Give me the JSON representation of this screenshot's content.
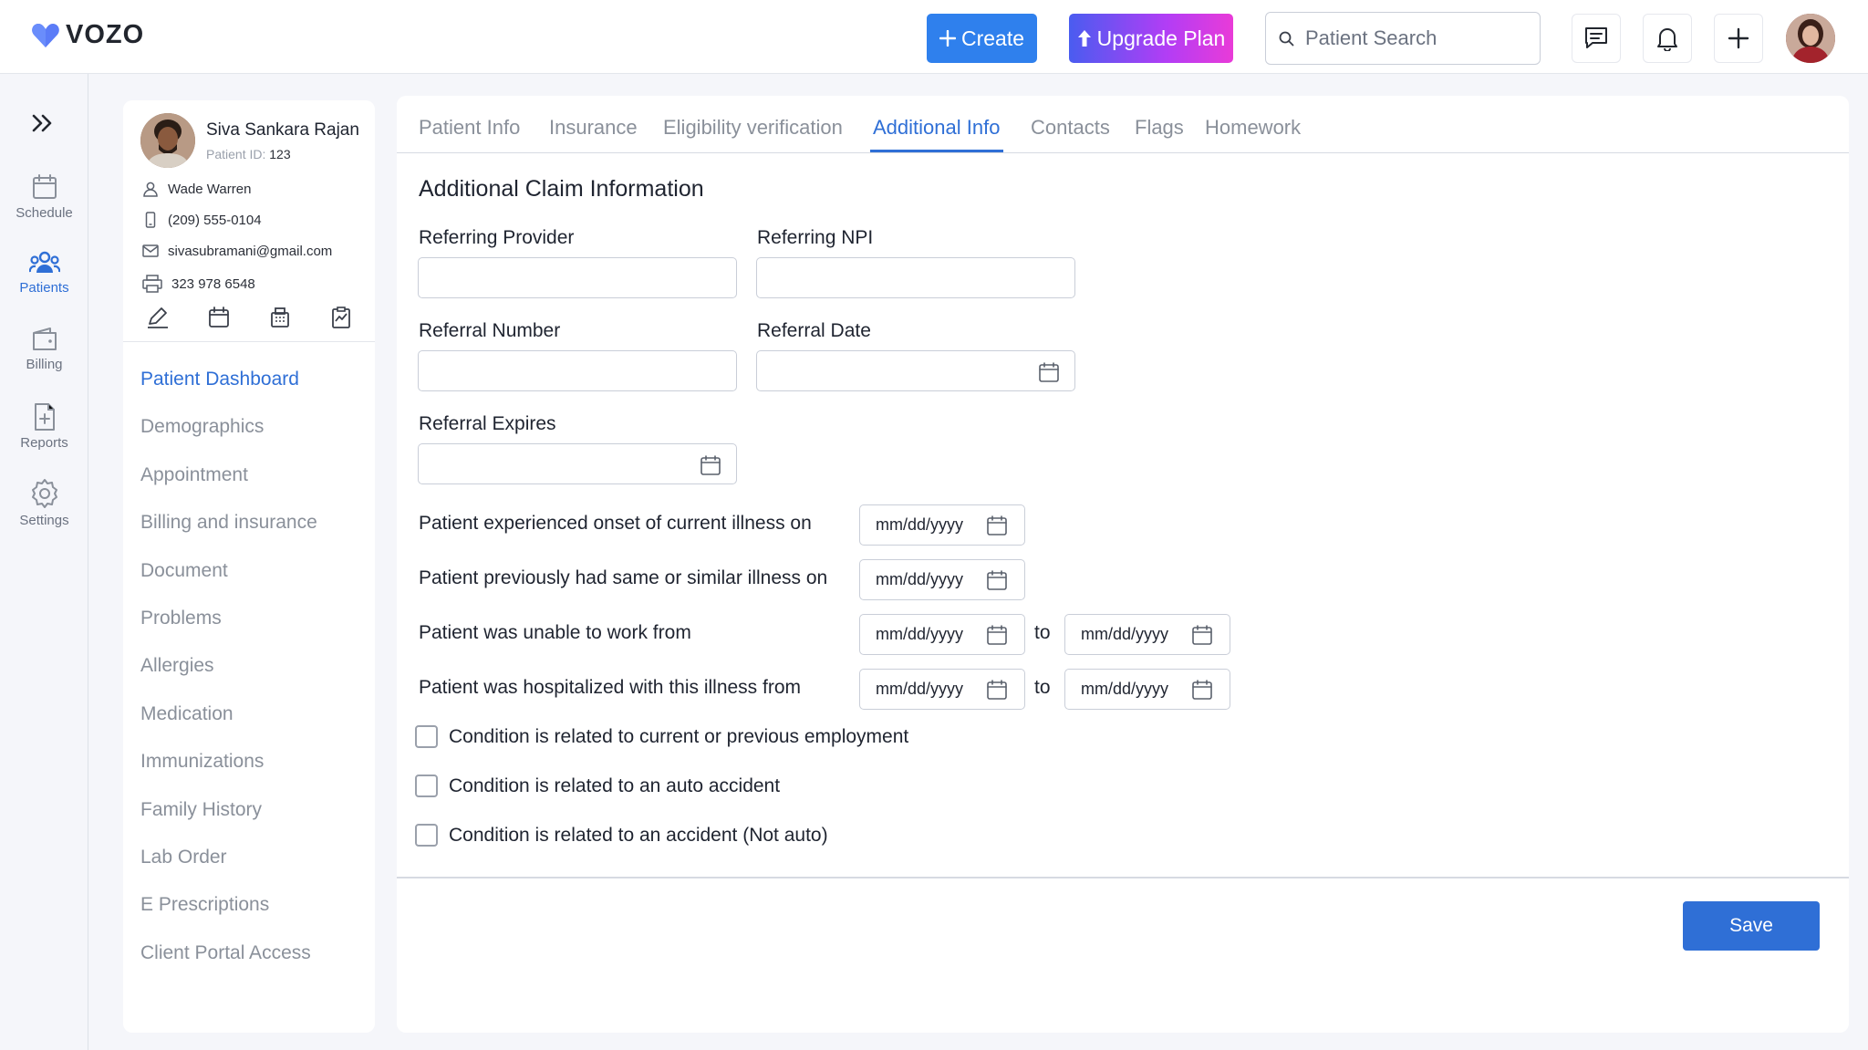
{
  "app": {
    "name": "VOZO"
  },
  "header": {
    "create_label": "Create",
    "upgrade_label": "Upgrade Plan",
    "search_placeholder": "Patient Search"
  },
  "rail": {
    "items": [
      {
        "label": "Schedule",
        "icon": "calendar-icon"
      },
      {
        "label": "Patients",
        "icon": "users-icon",
        "active": true
      },
      {
        "label": "Billing",
        "icon": "wallet-icon"
      },
      {
        "label": "Reports",
        "icon": "report-icon"
      },
      {
        "label": "Settings",
        "icon": "gear-icon"
      }
    ]
  },
  "patient": {
    "name": "Siva Sankara Rajan",
    "id_label": "Patient ID:",
    "id_value": "123",
    "provider": "Wade Warren",
    "phone": "(209) 555-0104",
    "email": "sivasubramani@gmail.com",
    "fax": "323 978 6548"
  },
  "patient_nav": [
    {
      "label": "Patient Dashboard",
      "active": true
    },
    {
      "label": "Demographics"
    },
    {
      "label": "Appointment"
    },
    {
      "label": "Billing and insurance"
    },
    {
      "label": "Document"
    },
    {
      "label": "Problems"
    },
    {
      "label": "Allergies"
    },
    {
      "label": "Medication"
    },
    {
      "label": "Immunizations"
    },
    {
      "label": "Family History"
    },
    {
      "label": "Lab Order"
    },
    {
      "label": "E Prescriptions"
    },
    {
      "label": "Client Portal Access"
    }
  ],
  "tabs": [
    {
      "label": "Patient Info"
    },
    {
      "label": "Insurance"
    },
    {
      "label": "Eligibility verification"
    },
    {
      "label": "Additional Info",
      "active": true
    },
    {
      "label": "Contacts"
    },
    {
      "label": "Flags"
    },
    {
      "label": "Homework"
    }
  ],
  "form": {
    "title": "Additional Claim Information",
    "referring_provider": "Referring Provider",
    "referring_npi": "Referring NPI",
    "referral_number": "Referral Number",
    "referral_date": "Referral Date",
    "referral_expires": "Referral Expires",
    "onset_label": "Patient experienced onset of current illness on",
    "similar_label": "Patient previously had same or similar illness on",
    "unable_work_label": "Patient was unable to work from",
    "hospitalized_label": "Patient was hospitalized with this illness from",
    "date_placeholder": "mm/dd/yyyy",
    "to_word": "to",
    "checkboxes": [
      "Condition is related to current or previous employment",
      "Condition is related to an auto accident",
      "Condition is related to an accident (Not auto)"
    ],
    "save_label": "Save"
  }
}
